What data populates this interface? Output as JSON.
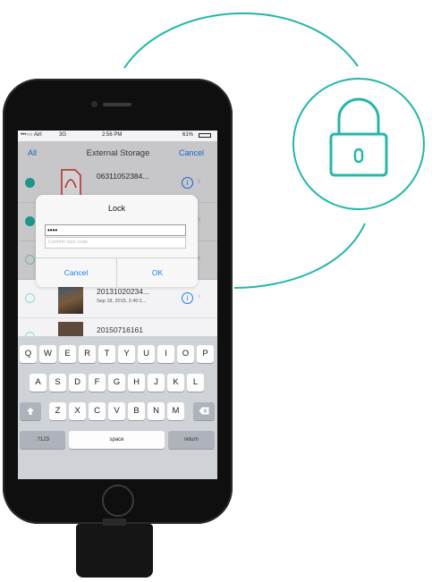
{
  "status_bar": {
    "carrier": "•••○○ Airl",
    "network": "3G",
    "time": "2:56 PM",
    "battery": "61%"
  },
  "nav": {
    "left_label": "All",
    "title": "External Storage",
    "right_label": "Cancel"
  },
  "files": [
    {
      "name": "06311052384...",
      "meta": "",
      "selected": true
    },
    {
      "name": "",
      "meta": "",
      "selected": true
    },
    {
      "name": "",
      "meta": "",
      "selected": false
    },
    {
      "name": "20131020234...",
      "meta": "Sep 18, 2015, 2:40:1...",
      "selected": false
    },
    {
      "name": "20150716161",
      "meta": "",
      "selected": false
    }
  ],
  "dialog": {
    "title": "Lock",
    "passcode_value": "••••",
    "confirm_placeholder": "Confirm lock code",
    "cancel_label": "Cancel",
    "ok_label": "OK"
  },
  "keyboard": {
    "row1": [
      "Q",
      "W",
      "E",
      "R",
      "T",
      "Y",
      "U",
      "I",
      "O",
      "P"
    ],
    "row2": [
      "A",
      "S",
      "D",
      "F",
      "G",
      "H",
      "J",
      "K",
      "L"
    ],
    "row3": [
      "Z",
      "X",
      "C",
      "V",
      "B",
      "N",
      "M"
    ],
    "numbers_label": ".?123",
    "space_label": "space",
    "return_label": "return"
  },
  "icons": {
    "lock": "lock-icon",
    "shift": "shift-icon",
    "backspace": "backspace-icon",
    "info": "info-icon",
    "chevron": "chevron-right-icon"
  },
  "colors": {
    "accent_teal": "#21b8a8",
    "ios_blue": "#1a7cf5"
  }
}
